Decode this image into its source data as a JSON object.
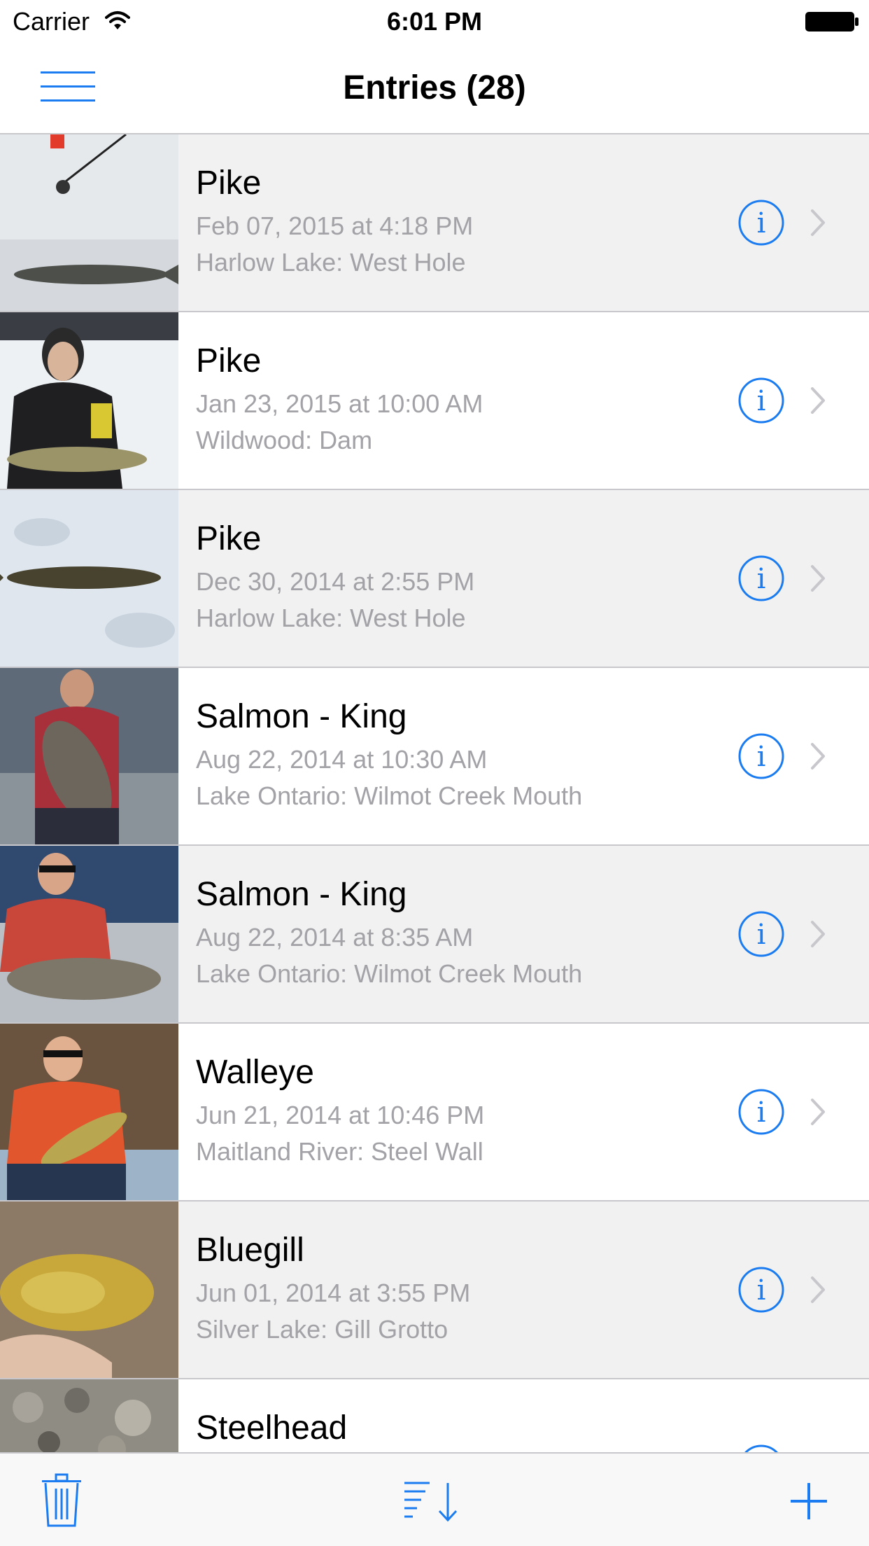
{
  "status_bar": {
    "carrier": "Carrier",
    "time": "6:01 PM",
    "wifi_icon": "wifi-icon",
    "battery_icon": "battery-full-icon"
  },
  "nav": {
    "title": "Entries (28)",
    "menu_icon": "hamburger-menu-icon"
  },
  "accent_color": "#1a7cf0",
  "entries": [
    {
      "title": "Pike",
      "date": "Feb 07, 2015 at 4:18 PM",
      "location": "Harlow Lake: West Hole"
    },
    {
      "title": "Pike",
      "date": "Jan 23, 2015 at 10:00 AM",
      "location": "Wildwood: Dam"
    },
    {
      "title": "Pike",
      "date": "Dec 30, 2014 at 2:55 PM",
      "location": "Harlow Lake: West Hole"
    },
    {
      "title": "Salmon - King",
      "date": "Aug 22, 2014 at 10:30 AM",
      "location": "Lake Ontario: Wilmot Creek Mouth"
    },
    {
      "title": "Salmon - King",
      "date": "Aug 22, 2014 at 8:35 AM",
      "location": "Lake Ontario: Wilmot Creek Mouth"
    },
    {
      "title": "Walleye",
      "date": "Jun 21, 2014 at 10:46 PM",
      "location": "Maitland River: Steel Wall"
    },
    {
      "title": "Bluegill",
      "date": "Jun 01, 2014 at 3:55 PM",
      "location": "Silver Lake: Gill Grotto"
    },
    {
      "title": "Steelhead",
      "date": "",
      "location": ""
    }
  ],
  "toolbar": {
    "trash_icon": "trash-icon",
    "sort_icon": "sort-icon",
    "add_icon": "plus-icon"
  }
}
